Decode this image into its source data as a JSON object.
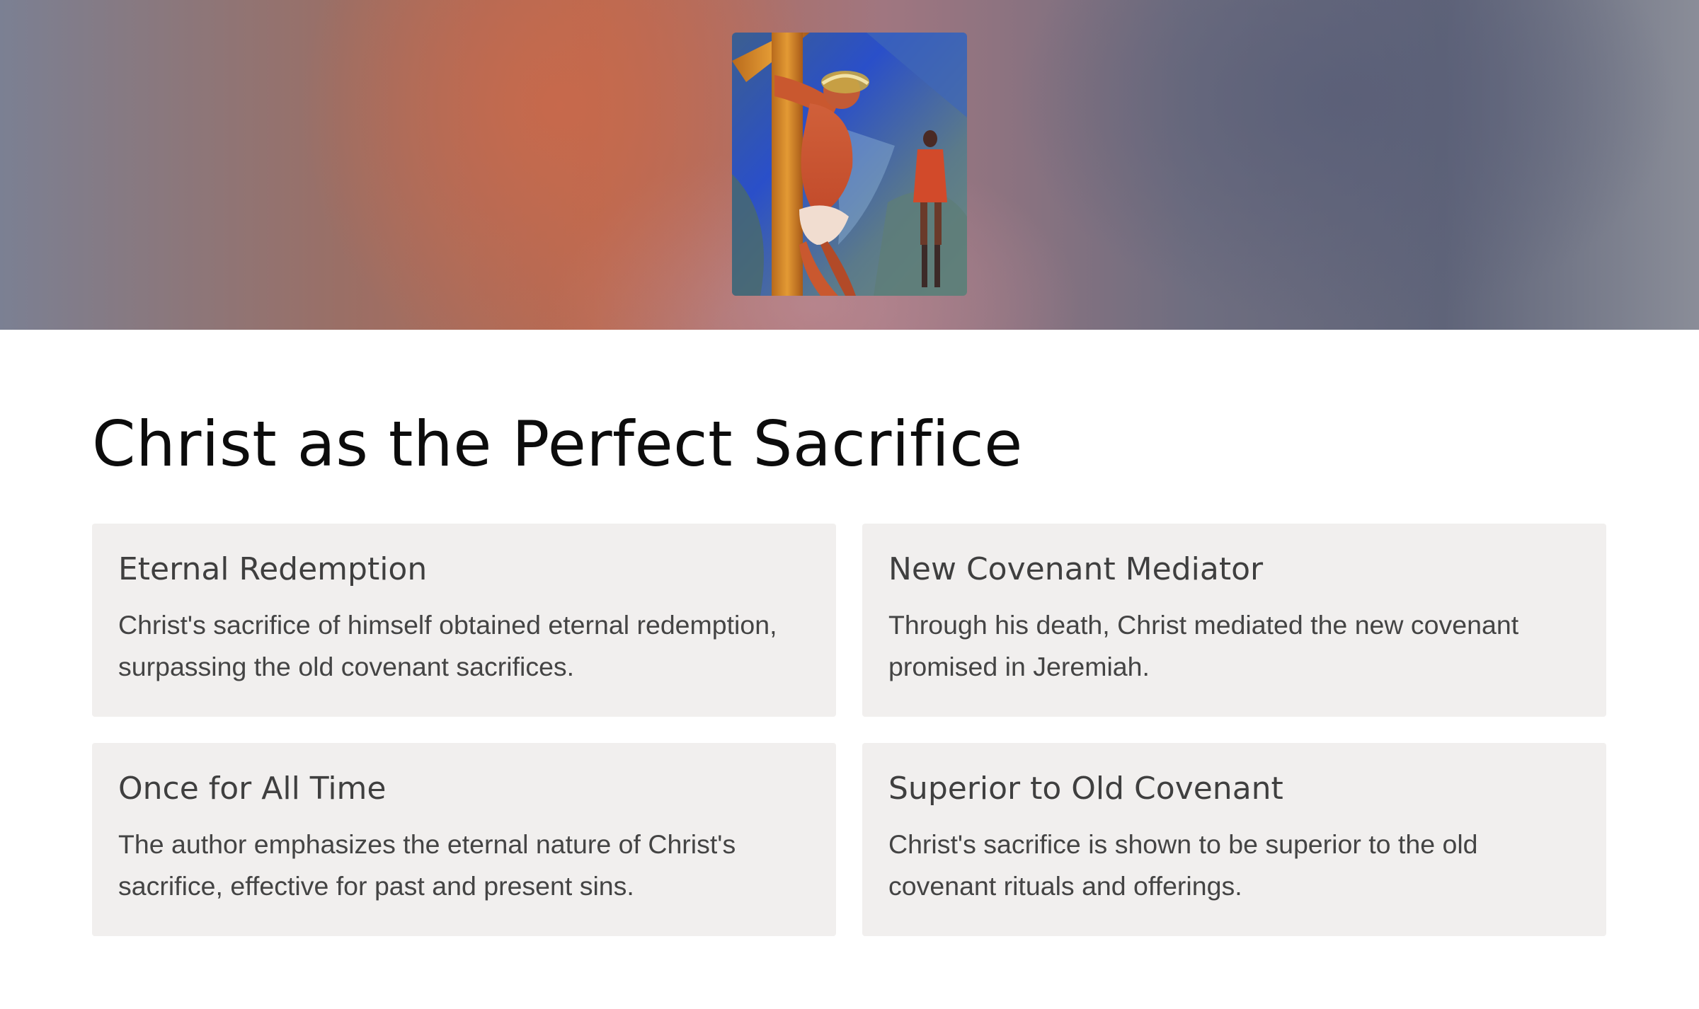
{
  "header": {
    "image_icon": "crucifixion-painting"
  },
  "title": "Christ as the Perfect Sacrifice",
  "cards": [
    {
      "title": "Eternal Redemption",
      "body": "Christ's sacrifice of himself obtained eternal redemption, surpassing the old covenant sacrifices."
    },
    {
      "title": "New Covenant Mediator",
      "body": "Through his death, Christ mediated the new covenant promised in Jeremiah."
    },
    {
      "title": "Once for All Time",
      "body": "The author emphasizes the eternal nature of Christ's sacrifice, effective for past and present sins."
    },
    {
      "title": "Superior to Old Covenant",
      "body": "Christ's sacrifice is shown to be superior to the old covenant rituals and offerings."
    }
  ],
  "colors": {
    "card_background": "#f1efee",
    "title_text": "#0c0c0c",
    "card_text": "#444444"
  }
}
